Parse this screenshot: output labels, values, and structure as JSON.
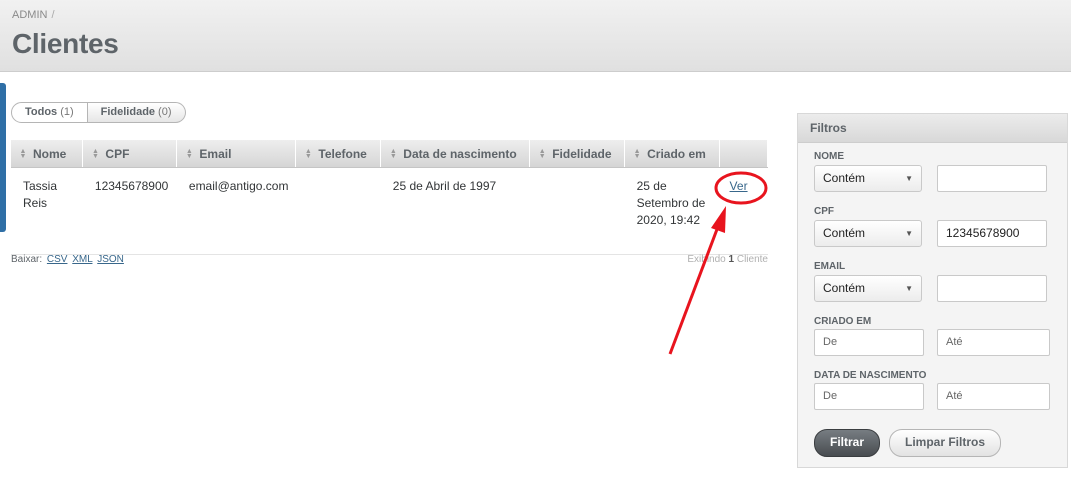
{
  "header": {
    "breadcrumb": "ADMIN",
    "breadcrumb_sep": "/",
    "title": "Clientes"
  },
  "scopes": [
    {
      "label": "Todos",
      "count": "(1)"
    },
    {
      "label": "Fidelidade",
      "count": "(0)"
    }
  ],
  "table": {
    "columns": [
      "Nome",
      "CPF",
      "Email",
      "Telefone",
      "Data de nascimento",
      "Fidelidade",
      "Criado em"
    ],
    "rows": [
      {
        "nome_line1": "Tassia",
        "nome_line2": "Reis",
        "cpf": "12345678900",
        "email": "email@antigo.com",
        "telefone": "",
        "nascimento": "25 de Abril de 1997",
        "fidelidade": "",
        "criado_line1": "25 de",
        "criado_line2": "Setembro de",
        "criado_line3": "2020, 19:42",
        "action": "Ver"
      }
    ]
  },
  "download": {
    "label": "Baixar:",
    "csv": "CSV",
    "xml": "XML",
    "json": "JSON"
  },
  "pagination": {
    "prefix": "Exibindo",
    "count": "1",
    "suffix": "Cliente"
  },
  "filters": {
    "title": "Filtros",
    "nome_label": "NOME",
    "nome_op": "Contém",
    "nome_value": "",
    "cpf_label": "CPF",
    "cpf_op": "Contém",
    "cpf_value": "12345678900",
    "email_label": "EMAIL",
    "email_op": "Contém",
    "email_value": "",
    "criado_label": "CRIADO EM",
    "nasc_label": "DATA DE NASCIMENTO",
    "from_ph": "De",
    "to_ph": "Até",
    "submit": "Filtrar",
    "clear": "Limpar Filtros"
  },
  "colors": {
    "annotation": "#e8141e",
    "link": "#38678b",
    "accent": "#2f6fa6"
  }
}
